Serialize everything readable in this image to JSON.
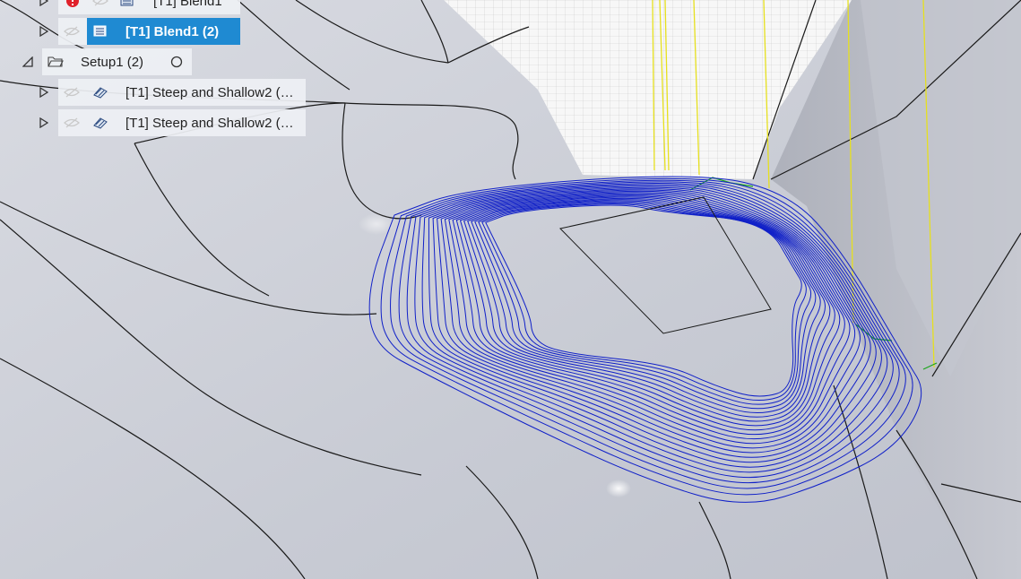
{
  "browser_tree": {
    "items": [
      {
        "label": "[T1] Blend1",
        "state": "warning"
      },
      {
        "label": "[T1] Blend1 (2)",
        "state": "selected"
      },
      {
        "label": "Setup1 (2)",
        "state": "setup"
      },
      {
        "label": "[T1] Steep and Shallow2 (…",
        "state": "normal"
      },
      {
        "label": "[T1] Steep and Shallow2 (…",
        "state": "normal"
      }
    ]
  },
  "icons": {
    "expand": "triangle-right-icon",
    "collapse": "triangle-down-icon",
    "visibility": "eye-hidden-icon",
    "error": "error-icon",
    "operation": "toolpath-operation-icon",
    "folder": "folder-open-icon",
    "radio": "circle-radio-icon"
  },
  "colors": {
    "selection": "#1f8ad2",
    "toolpath": "#1020c8",
    "lead_moves": "#e6e01e",
    "model_surface": "#cfd2da",
    "error": "#e0202a"
  }
}
